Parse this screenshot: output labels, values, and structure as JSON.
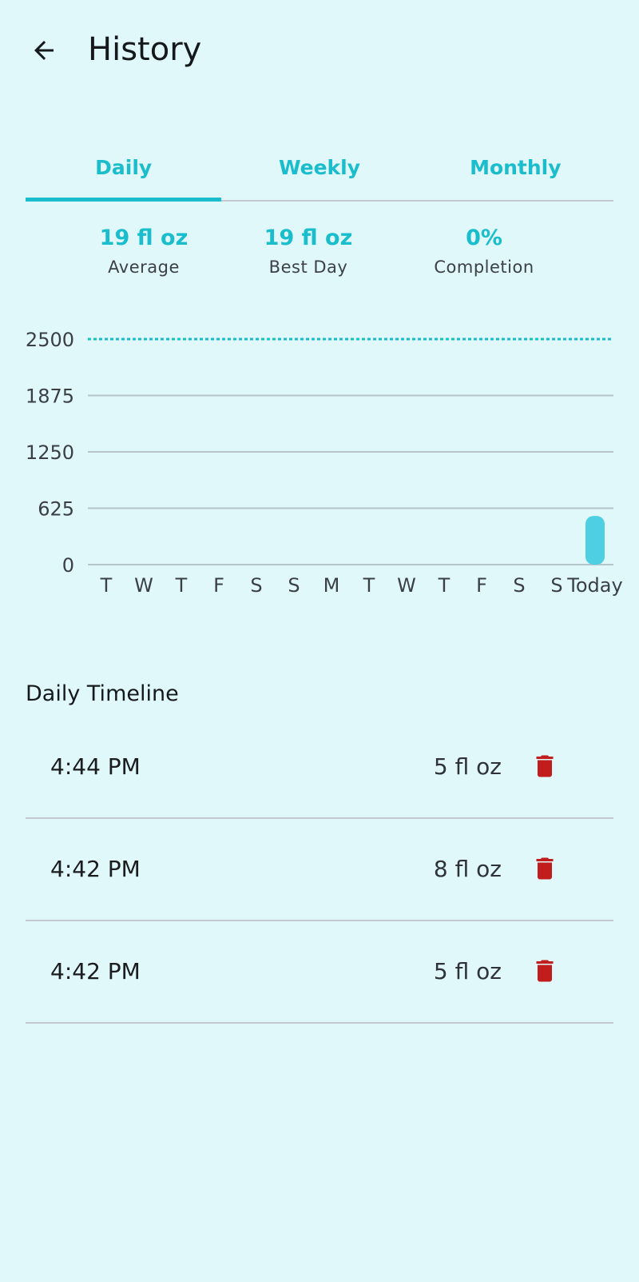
{
  "header": {
    "title": "History",
    "back_icon": "arrow-left-icon"
  },
  "tabs": [
    {
      "label": "Daily",
      "active": true
    },
    {
      "label": "Weekly",
      "active": false
    },
    {
      "label": "Monthly",
      "active": false
    }
  ],
  "stats": [
    {
      "value": "19 fl oz",
      "label": "Average"
    },
    {
      "value": "19 fl oz",
      "label": "Best Day"
    },
    {
      "value": "0%",
      "label": "Completion"
    }
  ],
  "chart_data": {
    "type": "bar",
    "categories": [
      "T",
      "W",
      "T",
      "F",
      "S",
      "S",
      "M",
      "T",
      "W",
      "T",
      "F",
      "S",
      "S",
      "Today"
    ],
    "values": [
      0,
      0,
      0,
      0,
      0,
      0,
      0,
      0,
      0,
      0,
      0,
      0,
      0,
      540
    ],
    "yticks": [
      "0",
      "625",
      "1250",
      "1875",
      "2500"
    ],
    "ylim": [
      0,
      2500
    ],
    "goal": 2500,
    "grid": true,
    "colors": {
      "bar": "#4fd0e2",
      "goal": "#19bdcc",
      "grid": "#b5c4cb"
    }
  },
  "timeline": {
    "title": "Daily Timeline",
    "entries": [
      {
        "time": "4:44 PM",
        "amount": "5 fl oz"
      },
      {
        "time": "4:42 PM",
        "amount": "8 fl oz"
      },
      {
        "time": "4:42 PM",
        "amount": "5 fl oz"
      }
    ],
    "delete_icon": "trash-icon",
    "delete_color": "#c11d1d"
  }
}
